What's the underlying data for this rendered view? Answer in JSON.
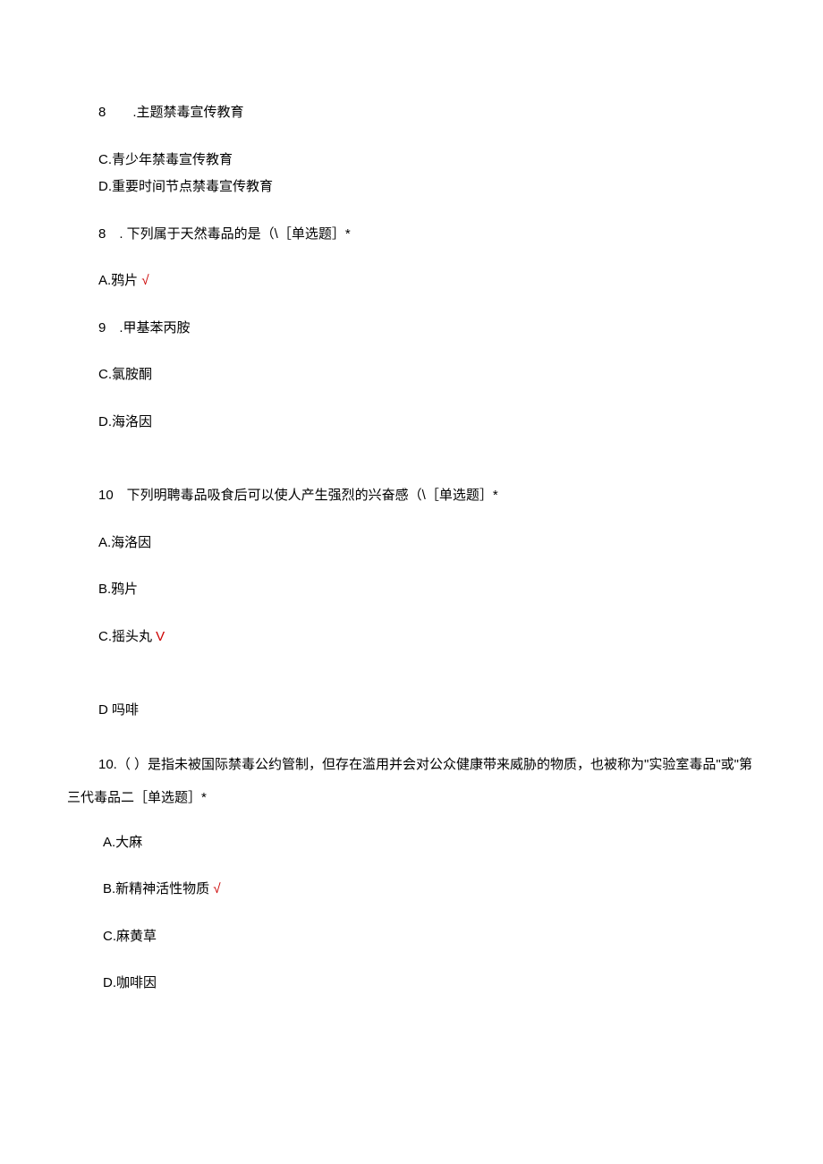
{
  "lines": {
    "l1": "8  .主题禁毒宣传教育",
    "l2": "C.青少年禁毒宣传教育",
    "l3": "D.重要时间节点禁毒宣传教育",
    "l4": "8 . 下列属于天然毒品的是（\\［单选题］*",
    "l5a": "A.鸦片 ",
    "l5b": "√",
    "l6": "9 .甲基苯丙胺",
    "l7": "C.氯胺酮",
    "l8": "D.海洛因",
    "l9": "10 下列明聘毒品吸食后可以使人产生强烈的兴奋感（\\［单选题］*",
    "l10": "A.海洛因",
    "l11": "B.鸦片",
    "l12a": "C.摇头丸 ",
    "l12b": "V",
    "l13": "D 吗啡",
    "l14": "10.（ ）是指未被国际禁毒公约管制，但存在滥用并会对公众健康带来威胁的物质，也被称为\"实验室毒品\"或\"第三代毒品二［单选题］*",
    "l15": "A.大麻",
    "l16a": "B.新精神活性物质 ",
    "l16b": "√",
    "l17": "C.麻黄草",
    "l18": "D.咖啡因"
  }
}
